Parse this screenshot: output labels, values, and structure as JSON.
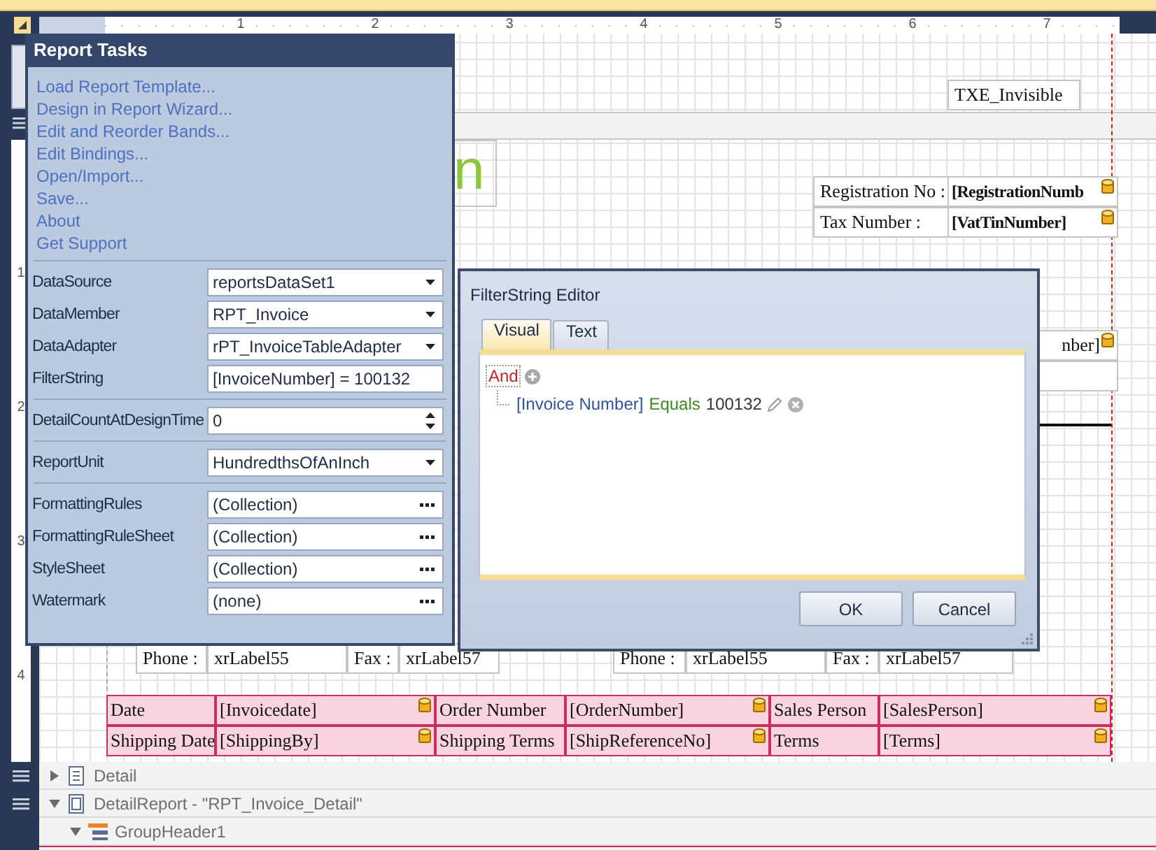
{
  "ruler": {
    "marks": [
      "1",
      "2",
      "3",
      "4",
      "5",
      "6",
      "7"
    ]
  },
  "vertical_ruler": {
    "marks": [
      "1",
      "2",
      "3",
      "4"
    ]
  },
  "report_tasks": {
    "title": "Report Tasks",
    "links": [
      "Load Report Template...",
      "Design in Report Wizard...",
      "Edit and Reorder Bands...",
      "Edit Bindings...",
      "Open/Import...",
      "Save...",
      "About",
      "Get Support"
    ],
    "property_groups": [
      [
        {
          "label": "DataSource",
          "value": "reportsDataSet1",
          "kind": "dropdown"
        },
        {
          "label": "DataMember",
          "value": "RPT_Invoice",
          "kind": "dropdown"
        },
        {
          "label": "DataAdapter",
          "value": "rPT_InvoiceTableAdapter",
          "kind": "dropdown"
        },
        {
          "label": "FilterString",
          "value": "[InvoiceNumber] = 100132",
          "kind": "text"
        }
      ],
      [
        {
          "label": "DetailCountAtDesignTime",
          "value": "0",
          "kind": "spin"
        }
      ],
      [
        {
          "label": "ReportUnit",
          "value": "HundredthsOfAnInch",
          "kind": "dropdown"
        }
      ],
      [
        {
          "label": "FormattingRules",
          "value": "(Collection)",
          "kind": "ellipsis"
        },
        {
          "label": "FormattingRuleSheet",
          "value": "(Collection)",
          "kind": "ellipsis"
        },
        {
          "label": "StyleSheet",
          "value": "(Collection)",
          "kind": "ellipsis"
        },
        {
          "label": "Watermark",
          "value": "(none)",
          "kind": "ellipsis"
        }
      ]
    ]
  },
  "design_surface": {
    "invisible_label": "TXE_Invisible",
    "logo_text": "n",
    "info_table": [
      {
        "label": "Registration No :",
        "field": "[RegistrationNumb",
        "bound": true
      },
      {
        "label": "Tax Number :",
        "field": "[VatTinNumber]",
        "bound": true
      }
    ],
    "partial_cell": {
      "text": "nber]",
      "bound": true
    },
    "contact_rows": [
      {
        "phone_label": "Phone :",
        "phone": "xrLabel55",
        "fax_label": "Fax :",
        "fax": "xrLabel57"
      },
      {
        "phone_label": "Phone :",
        "phone": "xrLabel55",
        "fax_label": "Fax :",
        "fax": "xrLabel57"
      }
    ],
    "detail_table": {
      "rows": [
        [
          {
            "text": "Date",
            "bound": false
          },
          {
            "text": "[Invoicedate]",
            "bound": true
          },
          {
            "text": "Order Number",
            "bound": false
          },
          {
            "text": "[OrderNumber]",
            "bound": true
          },
          {
            "text": "Sales Person",
            "bound": false
          },
          {
            "text": "[SalesPerson]",
            "bound": true
          }
        ],
        [
          {
            "text": "Shipping Date",
            "bound": false
          },
          {
            "text": "[ShippingBy]",
            "bound": true
          },
          {
            "text": "Shipping Terms",
            "bound": false
          },
          {
            "text": "[ShipReferenceNo]",
            "bound": true
          },
          {
            "text": "Terms",
            "bound": false
          },
          {
            "text": "[Terms]",
            "bound": true
          }
        ]
      ]
    }
  },
  "bands": [
    {
      "name": "Detail",
      "kind": "detail",
      "expanded": false
    },
    {
      "name": "DetailReport - \"RPT_Invoice_Detail\"",
      "kind": "detail_report",
      "expanded": true,
      "children": [
        {
          "name": "GroupHeader1",
          "kind": "group_header",
          "expanded": true
        }
      ]
    }
  ],
  "filter_editor": {
    "title": "FilterString Editor",
    "tabs": [
      {
        "label": "Visual",
        "selected": true
      },
      {
        "label": "Text",
        "selected": false
      }
    ],
    "tree": {
      "group": "And",
      "conditions": [
        {
          "field": "[Invoice Number]",
          "operator": "Equals",
          "value": "100132"
        }
      ]
    },
    "buttons": [
      "OK",
      "Cancel"
    ]
  }
}
